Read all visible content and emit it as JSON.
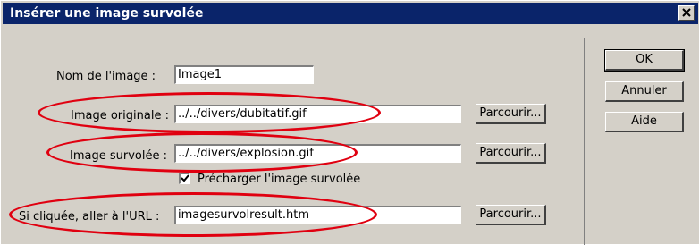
{
  "dialog": {
    "title": "Insérer une image survolée",
    "close_label": "×"
  },
  "form": {
    "name_label": "Nom de l'image :",
    "name_value": "Image1",
    "original_label": "Image originale :",
    "original_value": "../../divers/dubitatif.gif",
    "hover_label": "Image survolée :",
    "hover_value": "../../divers/explosion.gif",
    "preload_checked": true,
    "preload_label": "Précharger l'image survolée",
    "url_label": "Si cliquée, aller à l'URL :",
    "url_value": "imagesurvolresult.htm",
    "browse_label": "Parcourir..."
  },
  "actions": {
    "ok": "OK",
    "cancel": "Annuler",
    "help": "Aide"
  },
  "colors": {
    "titlebar": "#0a246a",
    "annotation": "#e00010",
    "dialog_bg": "#d4d0c8"
  },
  "icons": {
    "close": "close-icon",
    "check": "check-icon"
  }
}
